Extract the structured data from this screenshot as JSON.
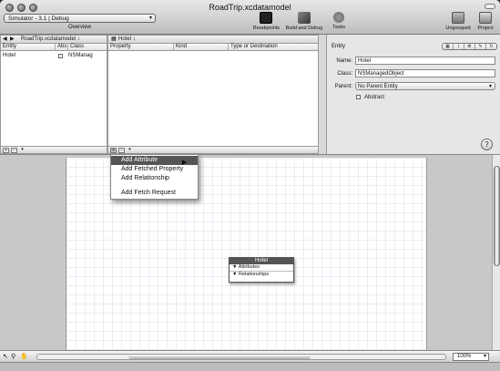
{
  "window": {
    "title": "RoadTrip.xcdatamodel"
  },
  "toolbar": {
    "overview_select": "Simulator - 3.1 | Debug",
    "overview_label": "Overview",
    "breakpoints": "Breakpoints",
    "build_debug": "Build and Debug",
    "tasks": "Tasks",
    "ungrouped": "Ungrouped",
    "project": "Project"
  },
  "entity_pane": {
    "file_popup": "RoadTrip.xcdatamodel ↕",
    "columns": [
      "Entity",
      "Abs",
      "Class"
    ],
    "rows": [
      {
        "entity": "Hotel",
        "class": "NSManag"
      }
    ]
  },
  "property_pane": {
    "entity_popup": "Hotel ↕",
    "columns": [
      "Property",
      "Kind",
      "Type or Destination"
    ]
  },
  "inspector": {
    "heading": "Entity",
    "name_label": "Name:",
    "name_value": "Hotel",
    "class_label": "Class:",
    "class_value": "NSManagedObject",
    "parent_label": "Parent:",
    "parent_value": "No Parent Entity",
    "abstract_label": "Abstract",
    "help": "?"
  },
  "menu": {
    "items": [
      "Add Attribute",
      "Add Fetched Property",
      "Add Relationship",
      "Add Fetch Request"
    ]
  },
  "diagram": {
    "entity_title": "Hotel",
    "attributes": "Attributes",
    "relationships": "Relationships"
  },
  "footer": {
    "zoom": "100%"
  }
}
